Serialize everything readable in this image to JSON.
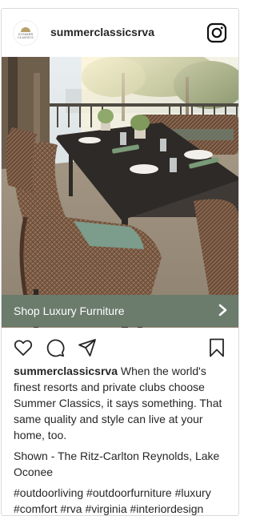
{
  "post": {
    "username": "summerclassicsrva",
    "avatar": {
      "line1": "SUMMER",
      "line2": "CLASSICS"
    },
    "shop_label": "Shop Luxury Furniture",
    "caption_user": "summerclassicsrva",
    "caption_text": "When the world's finest resorts and private clubs choose Summer Classics, it says something. That same quality and style can live at your home, too.",
    "shown_text": "Shown - The Ritz-Carlton Reynolds, Lake Oconee",
    "hashtags": "#outdoorliving #outdoorfurniture #luxury #comfort #rva #virginia #interiordesign"
  },
  "icons": {
    "header": "instagram-icon",
    "shop": "chevron-right-icon",
    "actions": [
      "heart-icon",
      "comment-icon",
      "share-icon",
      "bookmark-icon"
    ]
  },
  "colors": {
    "shop_bar": "#6b7b6c",
    "text": "#262626",
    "border": "#dbdbdb"
  }
}
